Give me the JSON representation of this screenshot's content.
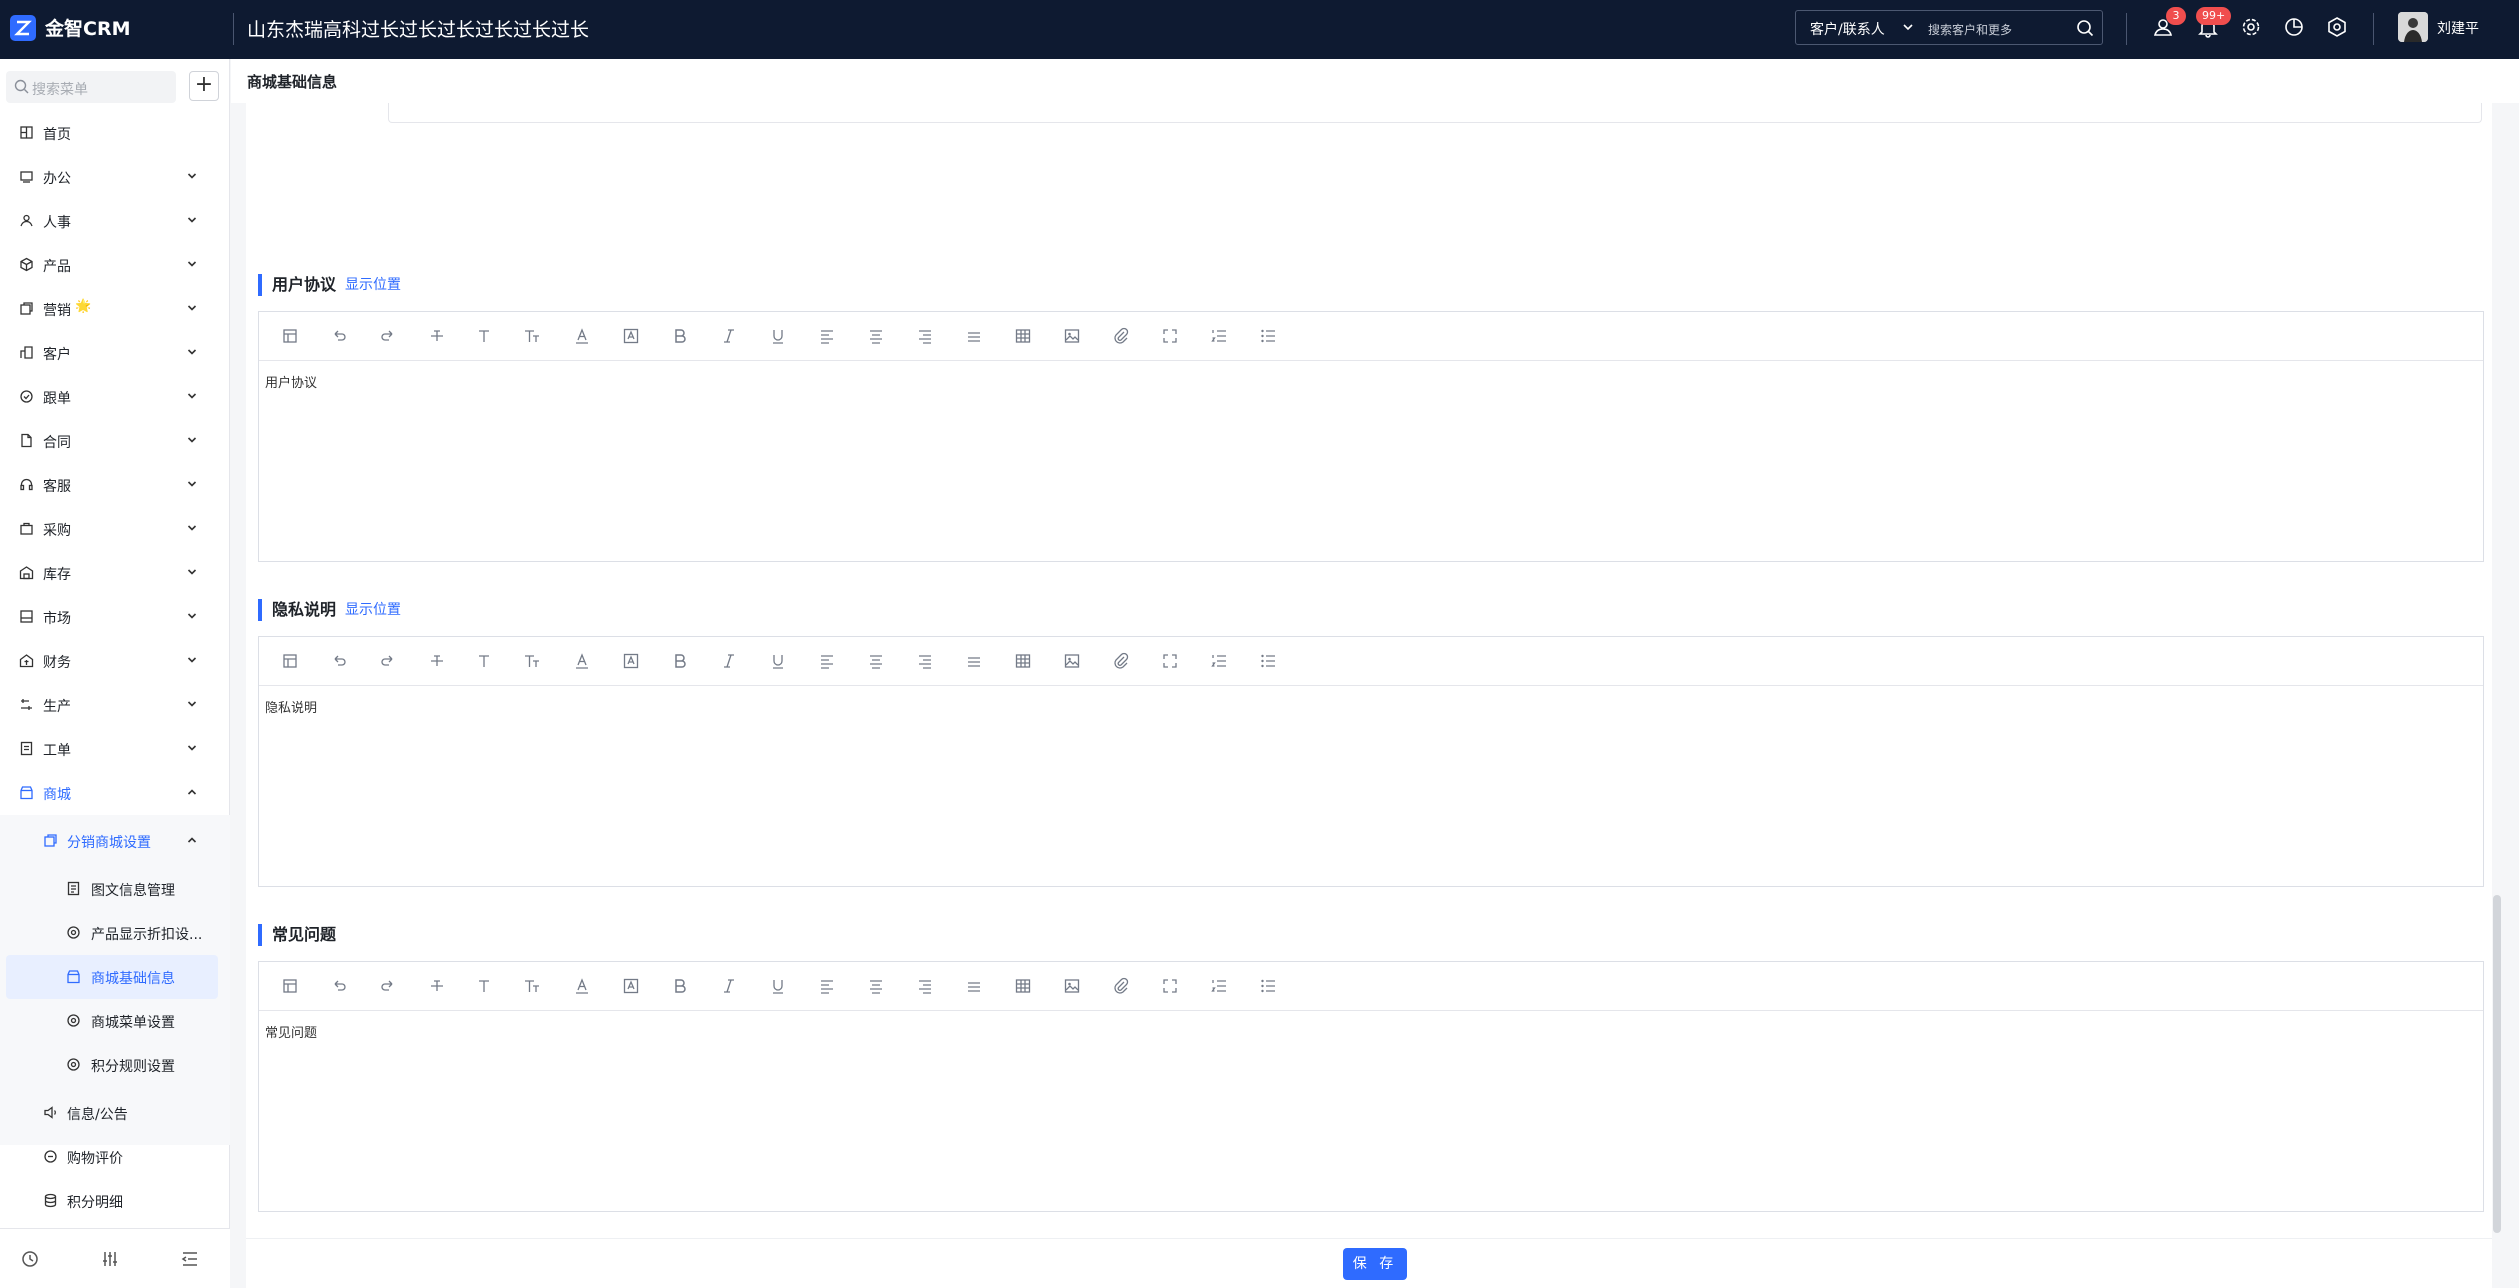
{
  "app": {
    "brand": "金智CRM",
    "company": "山东杰瑞高科过长过长过长过长过长过长"
  },
  "header_search": {
    "type_label": "客户/联系人",
    "placeholder": "搜索客户和更多"
  },
  "notifications": {
    "messages_badge": "3",
    "alerts_badge": "99+"
  },
  "user": {
    "name": "刘建平"
  },
  "sidebar": {
    "search_placeholder": "搜索菜单",
    "items": [
      {
        "label": "首页",
        "icon": "dashboard-icon"
      },
      {
        "label": "办公",
        "icon": "office-icon"
      },
      {
        "label": "人事",
        "icon": "people-icon"
      },
      {
        "label": "产品",
        "icon": "box-icon"
      },
      {
        "label": "营销",
        "icon": "marketing-icon",
        "emoji": "🌟"
      },
      {
        "label": "客户",
        "icon": "customer-icon"
      },
      {
        "label": "跟单",
        "icon": "followup-icon"
      },
      {
        "label": "合同",
        "icon": "contract-icon"
      },
      {
        "label": "客服",
        "icon": "headset-icon"
      },
      {
        "label": "采购",
        "icon": "purchase-icon"
      },
      {
        "label": "库存",
        "icon": "warehouse-icon"
      },
      {
        "label": "市场",
        "icon": "market-icon"
      },
      {
        "label": "财务",
        "icon": "finance-icon"
      },
      {
        "label": "生产",
        "icon": "production-icon"
      },
      {
        "label": "工单",
        "icon": "ticket-icon"
      },
      {
        "label": "商城",
        "icon": "shop-icon"
      }
    ],
    "shop_sub": {
      "label": "分销商城设置",
      "children": [
        "图文信息管理",
        "产品显示折扣设...",
        "商城基础信息",
        "商城菜单设置",
        "积分规则设置"
      ]
    },
    "shop_more": [
      "信息/公告",
      "购物评价",
      "积分明细"
    ]
  },
  "page": {
    "title": "商城基础信息"
  },
  "sections": [
    {
      "title": "用户协议",
      "link": "显示位置",
      "content": "用户协议"
    },
    {
      "title": "隐私说明",
      "link": "显示位置",
      "content": "隐私说明"
    },
    {
      "title": "常见问题",
      "link": "",
      "content": "常见问题"
    }
  ],
  "footer": {
    "save_label": "保 存"
  },
  "colors": {
    "accent": "#2f6bff",
    "topbar": "#0e1a31",
    "badge": "#f04e4e"
  }
}
